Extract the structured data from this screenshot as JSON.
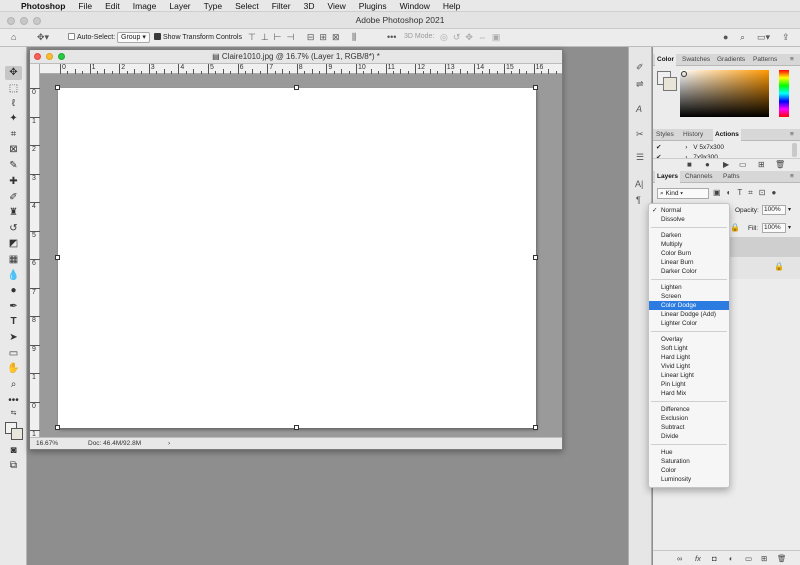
{
  "menubar": {
    "app": "Photoshop",
    "items": [
      "File",
      "Edit",
      "Image",
      "Layer",
      "Type",
      "Select",
      "Filter",
      "3D",
      "View",
      "Plugins",
      "Window",
      "Help"
    ]
  },
  "window_title": "Adobe Photoshop 2021",
  "options": {
    "auto_select_label": "Auto-Select:",
    "auto_select_value": "Group",
    "transform_label": "Show Transform Controls",
    "mode_3d": "3D Mode:"
  },
  "document": {
    "title": "Claire1010.jpg @ 16.7% (Layer 1, RGB/8*) *",
    "zoom": "16.67%",
    "doc_size": "Doc: 46.4M/92.8M",
    "h_ruler": [
      "0",
      "1",
      "2",
      "3",
      "4",
      "5",
      "6",
      "7",
      "8",
      "9",
      "10",
      "11",
      "12",
      "13",
      "14",
      "15",
      "16"
    ],
    "v_ruler": [
      "0",
      "1",
      "2",
      "3",
      "4",
      "5",
      "6",
      "7",
      "8",
      "9",
      "1",
      "0",
      "1"
    ]
  },
  "panels": {
    "color_tabs": [
      "Color",
      "Swatches",
      "Gradients",
      "Patterns"
    ],
    "action_tabs": [
      "Styles",
      "History",
      "Actions"
    ],
    "actions": [
      "V 5x7x300",
      "7x9x300"
    ],
    "layers_tabs": [
      "Layers",
      "Channels",
      "Paths"
    ],
    "kind_label": "Kind",
    "opacity_label": "Opacity:",
    "opacity_value": "100%",
    "fill_label": "Fill:",
    "fill_value": "100%"
  },
  "blend_modes": {
    "selected": "Normal",
    "highlighted": "Color Dodge",
    "groups": [
      [
        "Normal",
        "Dissolve"
      ],
      [
        "Darken",
        "Multiply",
        "Color Burn",
        "Linear Burn",
        "Darker Color"
      ],
      [
        "Lighten",
        "Screen",
        "Color Dodge",
        "Linear Dodge (Add)",
        "Lighter Color"
      ],
      [
        "Overlay",
        "Soft Light",
        "Hard Light",
        "Vivid Light",
        "Linear Light",
        "Pin Light",
        "Hard Mix"
      ],
      [
        "Difference",
        "Exclusion",
        "Subtract",
        "Divide"
      ],
      [
        "Hue",
        "Saturation",
        "Color",
        "Luminosity"
      ]
    ]
  },
  "colors": {
    "accent": "#2b7be0",
    "canvas": "#ffffff",
    "workspace": "#8e8e8e"
  },
  "icons": {
    "toolbar": [
      "move-tool-icon",
      "marquee-tool-icon",
      "lasso-tool-icon",
      "magic-wand-icon",
      "crop-tool-icon",
      "frame-tool-icon",
      "eyedropper-icon",
      "healing-brush-icon",
      "brush-tool-icon",
      "clone-stamp-icon",
      "history-brush-icon",
      "eraser-icon",
      "gradient-tool-icon",
      "blur-tool-icon",
      "dodge-tool-icon",
      "pen-tool-icon",
      "type-tool-icon",
      "path-select-icon",
      "rectangle-tool-icon",
      "hand-tool-icon",
      "zoom-tool-icon",
      "more-tools-icon",
      "swap-colors-icon",
      "foreground-color-swatch",
      "quick-mask-icon",
      "screen-mode-icon"
    ]
  }
}
